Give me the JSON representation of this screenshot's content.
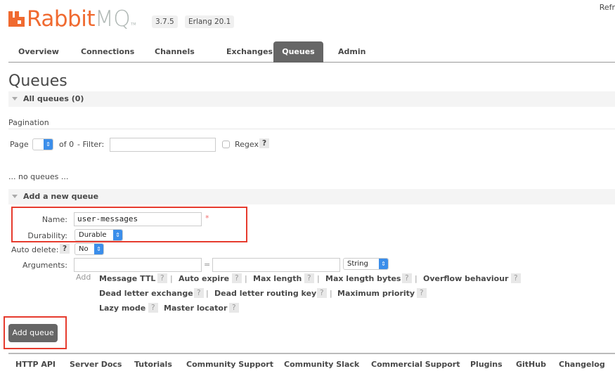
{
  "header": {
    "logo_primary": "Rabbit",
    "logo_secondary": "MQ",
    "logo_tm": "TM",
    "version_badge": "3.7.5",
    "erlang_badge": "Erlang 20.1",
    "refresh_text": "Refr",
    "brand_color": "#f06a30"
  },
  "tabs": [
    {
      "label": "Overview",
      "active": false
    },
    {
      "label": "Connections",
      "active": false
    },
    {
      "label": "Channels",
      "active": false
    },
    {
      "label": "Exchanges",
      "active": false
    },
    {
      "label": "Queues",
      "active": true
    },
    {
      "label": "Admin",
      "active": false
    }
  ],
  "page": {
    "title": "Queues",
    "all_queues_header": "All queues (0)",
    "pagination_label": "Pagination",
    "page_label": "Page",
    "page_value": "",
    "of_label": "of 0",
    "filter_label": "- Filter:",
    "filter_value": "",
    "regex_label": "Regex",
    "help_glyph": "?",
    "no_queues_text": "... no queues ..."
  },
  "add_queue": {
    "section_header": "Add a new queue",
    "name_label": "Name:",
    "name_value": "user-messages",
    "required_marker": "*",
    "durability_label": "Durability:",
    "durability_value": "Durable",
    "auto_delete_label": "Auto delete:",
    "auto_delete_value": "No",
    "arguments_label": "Arguments:",
    "arg_key_value": "",
    "equals": "=",
    "arg_value_value": "",
    "arg_type_value": "String",
    "add_label": "Add",
    "separator": "|",
    "arg_links": {
      "message_ttl": "Message TTL",
      "auto_expire": "Auto expire",
      "max_length": "Max length",
      "max_length_bytes": "Max length bytes",
      "overflow_behaviour": "Overflow behaviour",
      "dead_letter_exchange": "Dead letter exchange",
      "dead_letter_routing_key": "Dead letter routing key",
      "maximum_priority": "Maximum priority",
      "lazy_mode": "Lazy mode",
      "master_locator": "Master locator"
    },
    "submit_label": "Add queue"
  },
  "footer": {
    "links": [
      "HTTP API",
      "Server Docs",
      "Tutorials",
      "Community Support",
      "Community Slack",
      "Commercial Support",
      "Plugins",
      "GitHub",
      "Changelog"
    ]
  },
  "highlight_color": "#e63b2e"
}
